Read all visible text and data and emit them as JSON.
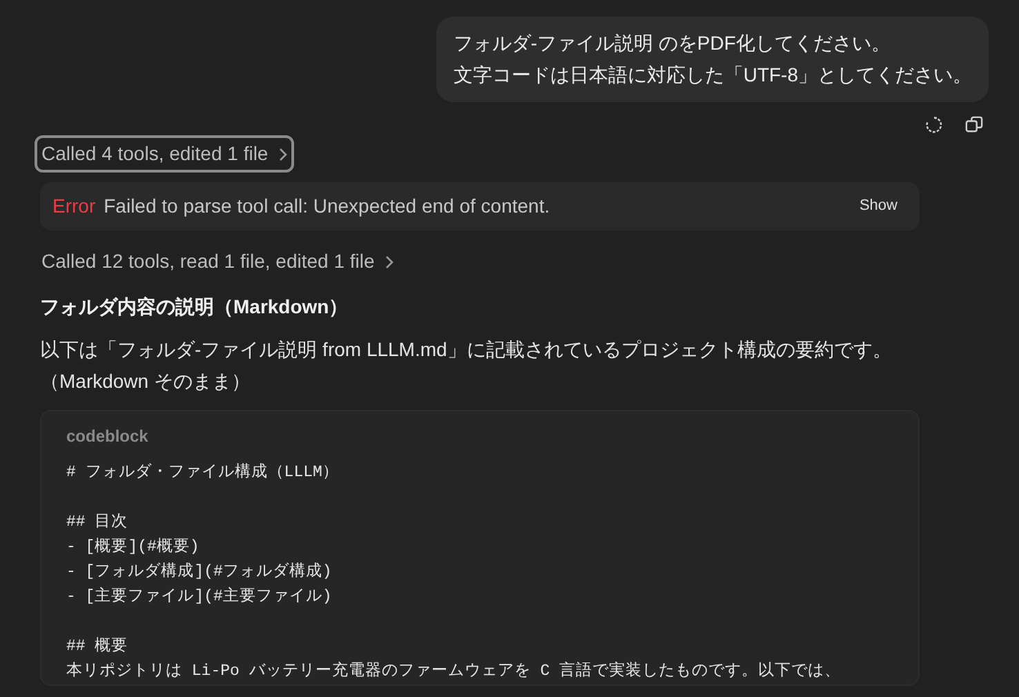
{
  "user_message": {
    "lines": [
      "フォルダ-ファイル説明 のをPDF化してください。",
      "文字コードは日本語に対応した「UTF-8」としてください。"
    ]
  },
  "tool_summary_1": {
    "label": "Called 4 tools, edited 1 file",
    "selected": true
  },
  "error": {
    "label": "Error",
    "message": "Failed to parse tool call: Unexpected end of content.",
    "button": "Show"
  },
  "tool_summary_2": {
    "label": "Called 12 tools, read 1 file, edited 1 file",
    "selected": false
  },
  "heading": "フォルダ内容の説明（Markdown）",
  "paragraph_lines": [
    "以下は「フォルダ-ファイル説明 from LLLM.md」に記載されているプロジェクト構成の要約です。",
    "（Markdown そのまま）"
  ],
  "codeblock": {
    "label": "codeblock",
    "blocks": [
      [
        "# フォルダ・ファイル構成（LLLM）"
      ],
      [
        "## 目次",
        "- [概要](#概要)",
        "- [フォルダ構成](#フォルダ構成)",
        "- [主要ファイル](#主要ファイル)"
      ],
      [
        "## 概要",
        "本リポジトリは Li-Po バッテリー充電器のファームウェアを C 言語で実装したものです。以下では、"
      ]
    ]
  }
}
